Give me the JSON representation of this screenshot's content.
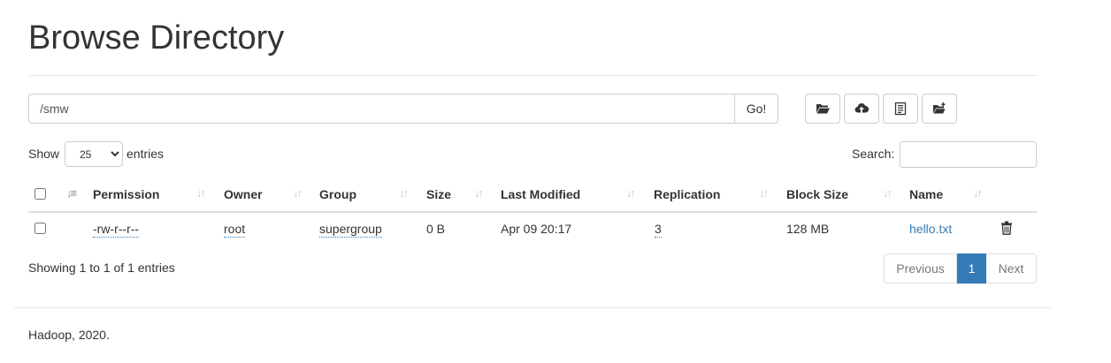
{
  "header": {
    "title": "Browse Directory"
  },
  "path": {
    "value": "/smw",
    "go_label": "Go!"
  },
  "toolbar": {
    "icons": [
      "folder-open-icon",
      "cloud-upload-icon",
      "list-alt-icon",
      "create-directory-icon"
    ]
  },
  "length": {
    "show_label": "Show",
    "selected": "25",
    "entries_label": "entries"
  },
  "search": {
    "label": "Search:",
    "value": ""
  },
  "table": {
    "columns": [
      "Permission",
      "Owner",
      "Group",
      "Size",
      "Last Modified",
      "Replication",
      "Block Size",
      "Name"
    ],
    "rows": [
      {
        "permission": "-rw-r--r--",
        "owner": "root",
        "group": "supergroup",
        "size": "0 B",
        "modified": "Apr 09 20:17",
        "replication": "3",
        "block_size": "128 MB",
        "name": "hello.txt"
      }
    ]
  },
  "info": "Showing 1 to 1 of 1 entries",
  "pagination": {
    "previous": "Previous",
    "current": "1",
    "next": "Next"
  },
  "footer": "Hadoop, 2020.",
  "colors": {
    "link": "#337ab7",
    "active_page": "#337ab7",
    "border": "#cccccc"
  }
}
